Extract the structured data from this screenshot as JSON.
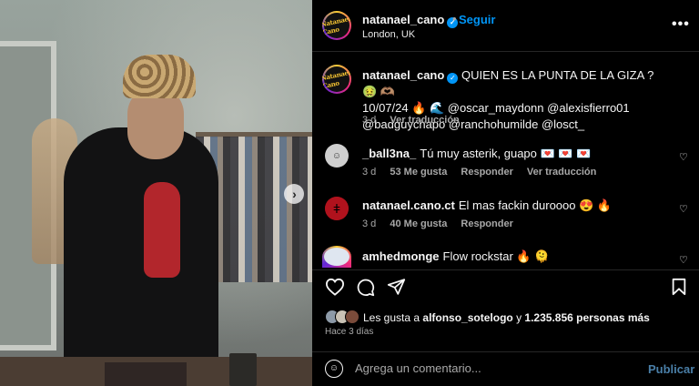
{
  "post": {
    "username": "natanael_cano",
    "follow_label": "Seguir",
    "dot": "•",
    "location": "London, UK",
    "more_label": "•••",
    "avatar_logo": "Natanael Cano",
    "caption": {
      "username": "natanael_cano",
      "text_line1": "QUIEN ES LA PUNTA DE LA GIZA ? 🤢 🫶🏽",
      "text_line2": "10/07/24 🔥 🌊 @oscar_maydonn @alexisfierro01",
      "text_line3": "@badguychapo @ranchohumilde @losct_",
      "time": "3 d",
      "translate": "Ver traducción"
    }
  },
  "comments": [
    {
      "username": "_ball3na_",
      "text": "Tú muy asterik, guapo 💌 💌 💌",
      "time": "3 d",
      "likes": "53 Me gusta",
      "reply": "Responder",
      "translate": "Ver traducción"
    },
    {
      "username": "natanael.cano.ct",
      "text": "El mas fackin duroooo 😍 🔥",
      "time": "3 d",
      "likes": "40 Me gusta",
      "reply": "Responder"
    },
    {
      "username": "amhedmonge",
      "text": "Flow rockstar 🔥 🫠"
    }
  ],
  "likes": {
    "prefix": "Les gusta a",
    "user": "alfonso_sotelogo",
    "middle": "y",
    "count": "1.235.856 personas más"
  },
  "time_ago": "Hace 3 días",
  "add_comment": {
    "placeholder": "Agrega un comentario...",
    "publish": "Publicar"
  },
  "icons": {
    "like": "heart-icon",
    "comment": "comment-icon",
    "share": "share-icon",
    "save": "bookmark-icon",
    "emoji": "emoji-icon",
    "next": "chevron-right-icon",
    "verified": "verified-badge-icon"
  }
}
